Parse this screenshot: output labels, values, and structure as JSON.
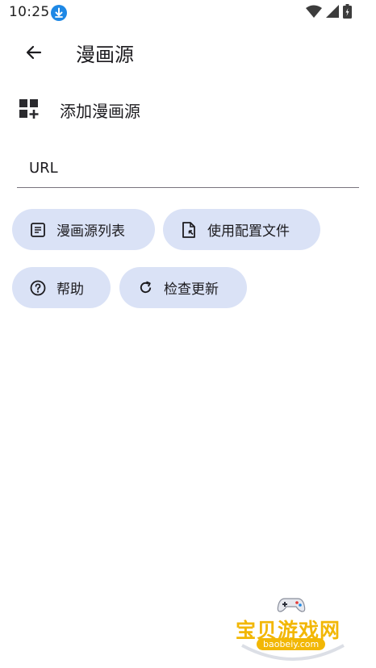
{
  "status_bar": {
    "time": "10:25",
    "icons": [
      "download-icon",
      "wifi-icon",
      "signal-icon",
      "battery-icon"
    ]
  },
  "app_bar": {
    "back_icon": "arrow-back-icon",
    "title": "漫画源"
  },
  "add_source": {
    "icon": "add-grid-icon",
    "label": "添加漫画源"
  },
  "url_input": {
    "placeholder": "URL",
    "value": ""
  },
  "chips": [
    {
      "icon": "list-icon",
      "label": "漫画源列表"
    },
    {
      "icon": "file-import-icon",
      "label": "使用配置文件"
    },
    {
      "icon": "help-icon",
      "label": "帮助"
    },
    {
      "icon": "refresh-icon",
      "label": "检查更新"
    }
  ],
  "watermark": {
    "text": "宝贝游戏网",
    "url": "baobeiy.com"
  },
  "colors": {
    "chip_background": "#dae2f6",
    "text": "#1c1b1f",
    "download_badge": "#1e88e5",
    "watermark": "#f2b705"
  }
}
